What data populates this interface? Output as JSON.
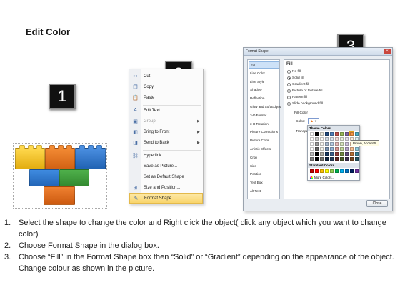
{
  "title": "Edit Color",
  "badges": [
    "1",
    "2",
    "3"
  ],
  "context_menu": {
    "items": [
      {
        "label": "Cut",
        "icon": "scissors-icon",
        "glyph": "✂",
        "disabled": false,
        "arrow": false
      },
      {
        "label": "Copy",
        "icon": "copy-icon",
        "glyph": "❐",
        "disabled": false,
        "arrow": false
      },
      {
        "label": "Paste",
        "icon": "paste-icon",
        "glyph": "📋",
        "disabled": false,
        "arrow": false
      },
      {
        "label": "Edit Text",
        "icon": "edit-text-icon",
        "glyph": "A",
        "disabled": false,
        "arrow": false
      },
      {
        "label": "Group",
        "icon": "group-icon",
        "glyph": "▣",
        "disabled": true,
        "arrow": true
      },
      {
        "label": "Bring to Front",
        "icon": "bring-to-front-icon",
        "glyph": "◧",
        "disabled": false,
        "arrow": true
      },
      {
        "label": "Send to Back",
        "icon": "send-to-back-icon",
        "glyph": "◨",
        "disabled": false,
        "arrow": true
      },
      {
        "label": "Hyperlink...",
        "icon": "hyperlink-icon",
        "glyph": "⛓",
        "disabled": false,
        "arrow": false
      },
      {
        "label": "Save as Picture...",
        "icon": "",
        "glyph": "",
        "disabled": false,
        "arrow": false
      },
      {
        "label": "Set as Default Shape",
        "icon": "",
        "glyph": "",
        "disabled": false,
        "arrow": false
      },
      {
        "label": "Size and Position...",
        "icon": "size-position-icon",
        "glyph": "⊞",
        "disabled": false,
        "arrow": false
      },
      {
        "label": "Format Shape...",
        "icon": "format-shape-icon",
        "glyph": "✎",
        "disabled": false,
        "arrow": false,
        "highlight": true
      }
    ]
  },
  "dialog": {
    "title": "Format Shape",
    "categories": [
      "Fill",
      "Line Color",
      "Line Style",
      "Shadow",
      "Reflection",
      "Glow and Soft Edges",
      "3-D Format",
      "3-D Rotation",
      "Picture Corrections",
      "Picture Color",
      "Artistic Effects",
      "Crop",
      "Size",
      "Position",
      "Text Box",
      "Alt Text"
    ],
    "panel_heading": "Fill",
    "options": [
      {
        "label": "No fill",
        "on": false
      },
      {
        "label": "Solid fill",
        "on": true
      },
      {
        "label": "Gradient fill",
        "on": false
      },
      {
        "label": "Picture or texture fill",
        "on": false
      },
      {
        "label": "Pattern fill",
        "on": false
      },
      {
        "label": "Slide background fill",
        "on": false
      }
    ],
    "fill_color_label": "Fill Color",
    "color_label": "Color:",
    "transparency_label": "Transpa",
    "close_label": "Close"
  },
  "color_picker": {
    "theme_label": "Theme Colors",
    "standard_label": "Standard Colors",
    "more_label": "More Colors...",
    "tooltip": "Brown, Accent 5",
    "theme_top": [
      "#ffffff",
      "#000000",
      "#eeece1",
      "#1f497d",
      "#4f81bd",
      "#c0504d",
      "#9bbb59",
      "#8064a2",
      "#f79646",
      "#4bacc6"
    ],
    "standard": [
      "#c00000",
      "#ff0000",
      "#ffc000",
      "#ffff00",
      "#92d050",
      "#00b050",
      "#00b0f0",
      "#0070c0",
      "#002060",
      "#7030a0"
    ]
  },
  "instructions": [
    {
      "num": "1.",
      "text": "Select the shape to change the color and Right click the object( click any object which you want to change color)"
    },
    {
      "num": "2.",
      "text": "Choose Format Shape in the dialog box."
    },
    {
      "num": "3.",
      "text": "Choose “Fill” in the Format Shape box then “Solid” or “Gradient” depending on the appearance of the object. Change colour as shown in the picture."
    }
  ],
  "colors": {
    "yellow": "#f5c31c",
    "orange": "#e8731a",
    "blue": "#2f74c9",
    "green": "#3d9a3a"
  }
}
